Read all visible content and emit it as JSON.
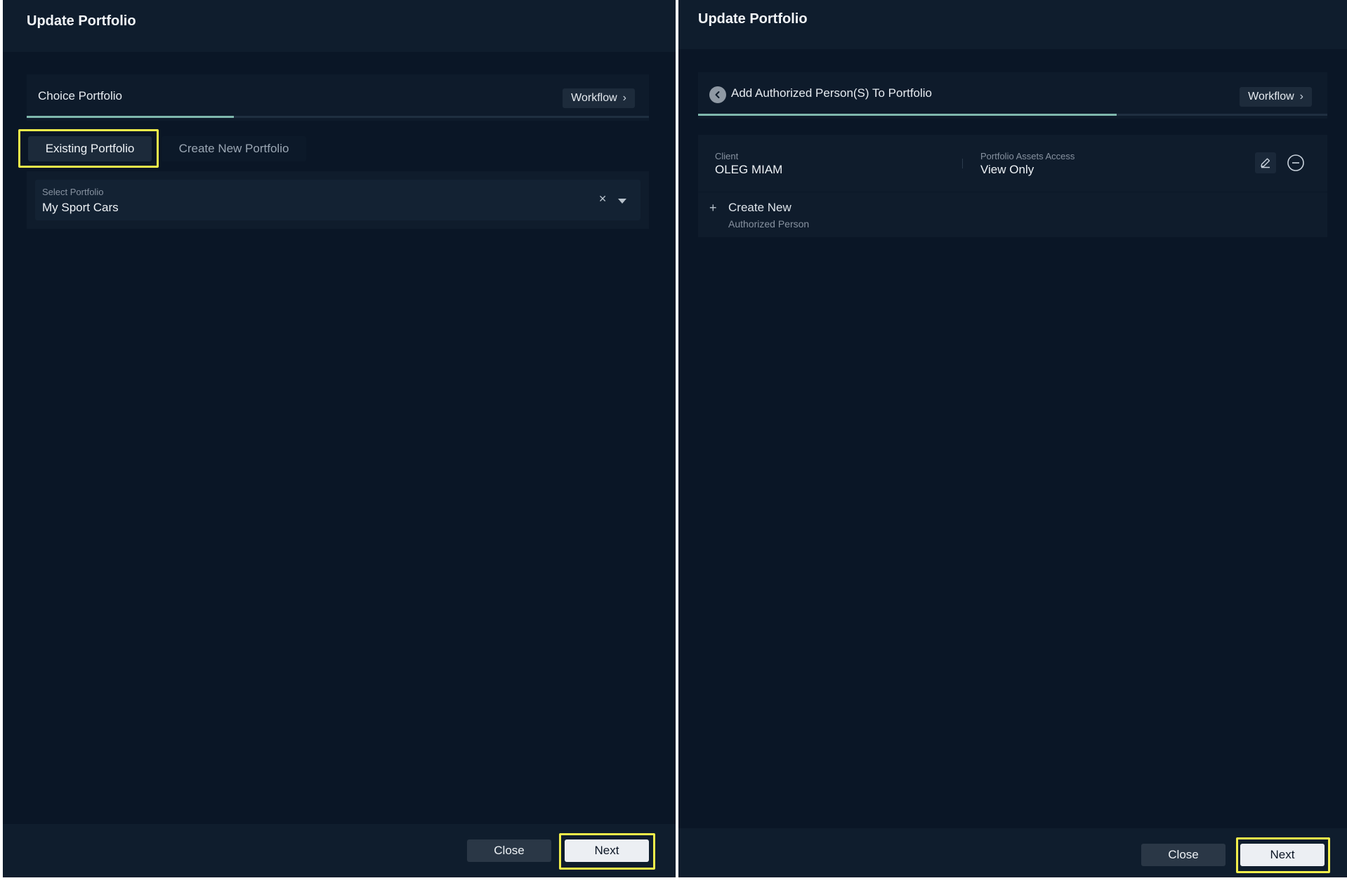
{
  "left_panel": {
    "title": "Update Portfolio",
    "step_label": "Choice Portfolio",
    "workflow_label": "Workflow",
    "tabs": [
      {
        "label": "Existing Portfolio",
        "active": true
      },
      {
        "label": "Create New Portfolio",
        "active": false
      }
    ],
    "select": {
      "label": "Select Portfolio",
      "value": "My Sport Cars"
    },
    "footer": {
      "close_label": "Close",
      "next_label": "Next"
    }
  },
  "right_panel": {
    "title": "Update Portfolio",
    "step_label": "Add Authorized Person(S) To Portfolio",
    "workflow_label": "Workflow",
    "person": {
      "client_label": "Client",
      "client_value": "OLEG MIAM",
      "access_label": "Portfolio Assets Access",
      "access_value": "View Only"
    },
    "create_new": {
      "title": "Create New",
      "subtitle": "Authorized Person"
    },
    "footer": {
      "close_label": "Close",
      "next_label": "Next"
    }
  },
  "colors": {
    "background": "#0a1626",
    "header": "#0f1d2d",
    "progress": "#7fb8ad",
    "highlight": "#f2ee4a"
  },
  "icons": [
    "chevron-right-icon",
    "clear-icon",
    "chevron-down-icon",
    "back-arrow-icon",
    "edit-icon",
    "remove-icon",
    "plus-icon"
  ]
}
